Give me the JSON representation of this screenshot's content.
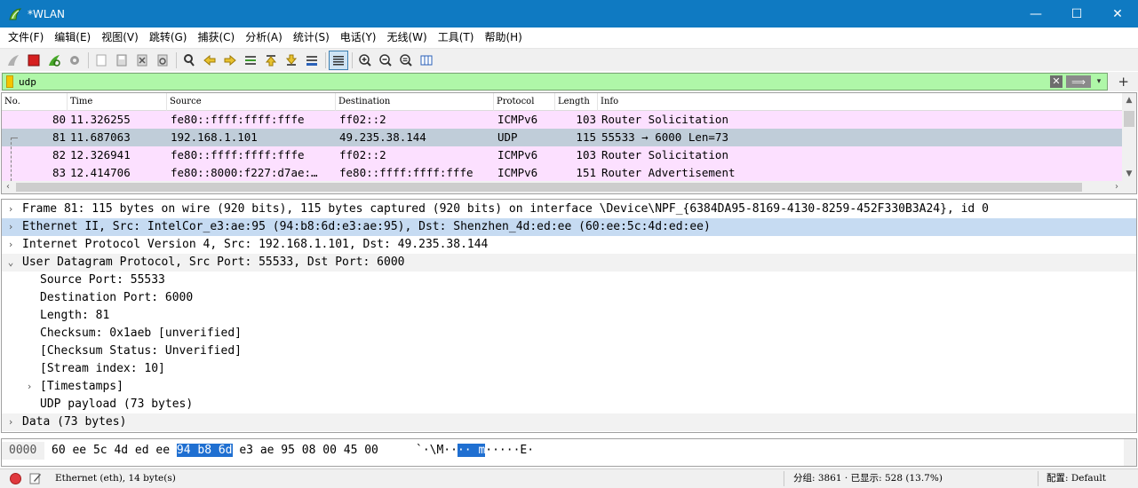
{
  "window": {
    "title": "*WLAN",
    "minimize": "—",
    "maximize": "☐",
    "close": "✕"
  },
  "menu": [
    "文件(F)",
    "编辑(E)",
    "视图(V)",
    "跳转(G)",
    "捕获(C)",
    "分析(A)",
    "统计(S)",
    "电话(Y)",
    "无线(W)",
    "工具(T)",
    "帮助(H)"
  ],
  "filter": {
    "value": "udp",
    "apply_glyph": "⟹",
    "dropdown_glyph": "▾",
    "add_glyph": "+",
    "clear_glyph": "✕"
  },
  "packet_list": {
    "columns": [
      "No.",
      "Time",
      "Source",
      "Destination",
      "Protocol",
      "Length",
      "Info"
    ],
    "rows": [
      {
        "no": "80",
        "time": "11.326255",
        "source": "fe80::ffff:ffff:fffe",
        "destination": "ff02::2",
        "protocol": "ICMPv6",
        "length": "103",
        "info": "Router Solicitation",
        "kind": "icmp"
      },
      {
        "no": "81",
        "time": "11.687063",
        "source": "192.168.1.101",
        "destination": "49.235.38.144",
        "protocol": "UDP",
        "length": "115",
        "info": "55533 → 6000 Len=73",
        "kind": "selected"
      },
      {
        "no": "82",
        "time": "12.326941",
        "source": "fe80::ffff:ffff:fffe",
        "destination": "ff02::2",
        "protocol": "ICMPv6",
        "length": "103",
        "info": "Router Solicitation",
        "kind": "icmp"
      },
      {
        "no": "83",
        "time": "12.414706",
        "source": "fe80::8000:f227:d7ae:…",
        "destination": "fe80::ffff:ffff:fffe",
        "protocol": "ICMPv6",
        "length": "151",
        "info": "Router Advertisement",
        "kind": "icmp"
      }
    ]
  },
  "details": [
    {
      "text": "Frame 81: 115 bytes on wire (920 bits), 115 bytes captured (920 bits) on interface \\Device\\NPF_{6384DA95-8169-4130-8259-452F330B3A24}, id 0",
      "indent": 0,
      "arrow": "›",
      "style": "plain"
    },
    {
      "text": "Ethernet II, Src: IntelCor_e3:ae:95 (94:b8:6d:e3:ae:95), Dst: Shenzhen_4d:ed:ee (60:ee:5c:4d:ed:ee)",
      "indent": 0,
      "arrow": "›",
      "style": "sel"
    },
    {
      "text": "Internet Protocol Version 4, Src: 192.168.1.101, Dst: 49.235.38.144",
      "indent": 0,
      "arrow": "›",
      "style": "plain"
    },
    {
      "text": "User Datagram Protocol, Src Port: 55533, Dst Port: 6000",
      "indent": 0,
      "arrow": "⌄",
      "style": "alt"
    },
    {
      "text": "Source Port: 55533",
      "indent": 1,
      "arrow": "",
      "style": "plain"
    },
    {
      "text": "Destination Port: 6000",
      "indent": 1,
      "arrow": "",
      "style": "plain"
    },
    {
      "text": "Length: 81",
      "indent": 1,
      "arrow": "",
      "style": "plain"
    },
    {
      "text": "Checksum: 0x1aeb [unverified]",
      "indent": 1,
      "arrow": "",
      "style": "plain"
    },
    {
      "text": "[Checksum Status: Unverified]",
      "indent": 1,
      "arrow": "",
      "style": "plain"
    },
    {
      "text": "[Stream index: 10]",
      "indent": 1,
      "arrow": "",
      "style": "plain"
    },
    {
      "text": "[Timestamps]",
      "indent": 1,
      "arrow": "›",
      "style": "plain"
    },
    {
      "text": "UDP payload (73 bytes)",
      "indent": 1,
      "arrow": "",
      "style": "plain"
    },
    {
      "text": "Data (73 bytes)",
      "indent": 0,
      "arrow": "›",
      "style": "alt"
    }
  ],
  "bytes": {
    "offset": "0000",
    "hex_before": "60 ee 5c 4d ed ee ",
    "hex_highlight": "94 b8 6d",
    "hex_after": " e3 ae 95 08 00 45 00",
    "ascii_before": "`·\\M··",
    "ascii_highlight": "·· m",
    "ascii_after": "·····E·"
  },
  "status": {
    "field_info": "Ethernet (eth), 14 byte(s)",
    "packets": "分组: 3861 · 已显示: 528 (13.7%)",
    "profile": "配置: Default"
  },
  "colors": {
    "titlebar": "#0f7ac2",
    "filter_bg": "#aff7a8",
    "icmp_row": "#fce0ff",
    "selected_row": "#c0cdd9",
    "byte_highlight": "#1f6fd1"
  }
}
